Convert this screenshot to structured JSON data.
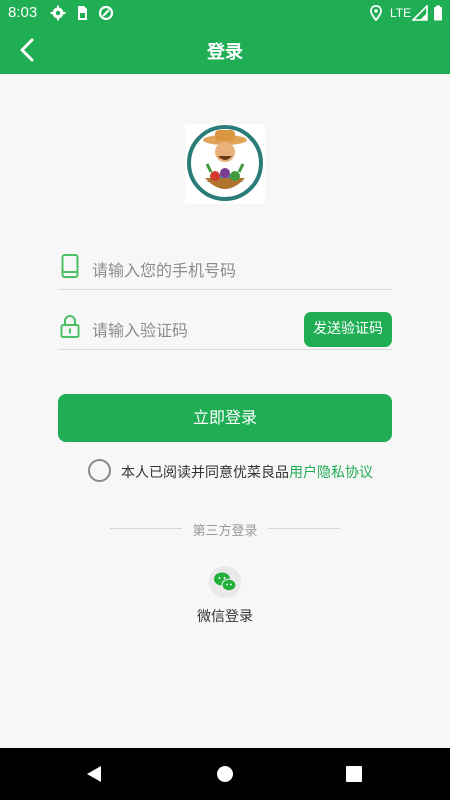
{
  "status_bar": {
    "time": "8:03",
    "network": "LTE"
  },
  "app_bar": {
    "title": "登录"
  },
  "form": {
    "phone_placeholder": "请输入您的手机号码",
    "code_placeholder": "请输入验证码",
    "send_code_label": "发送验证码",
    "login_label": "立即登录"
  },
  "agreement": {
    "text": "本人已阅读并同意优菜良品",
    "link": "用户隐私协议"
  },
  "third_party": {
    "heading": "第三方登录",
    "wechat_label": "微信登录"
  },
  "colors": {
    "brand_green": "#1fae54",
    "background": "#f7f7f7"
  },
  "icons": [
    "settings-icon",
    "sim-icon",
    "data-saver-icon",
    "location-icon",
    "signal-icon",
    "battery-icon",
    "back-arrow-icon",
    "phone-icon",
    "lock-icon",
    "wechat-icon"
  ]
}
